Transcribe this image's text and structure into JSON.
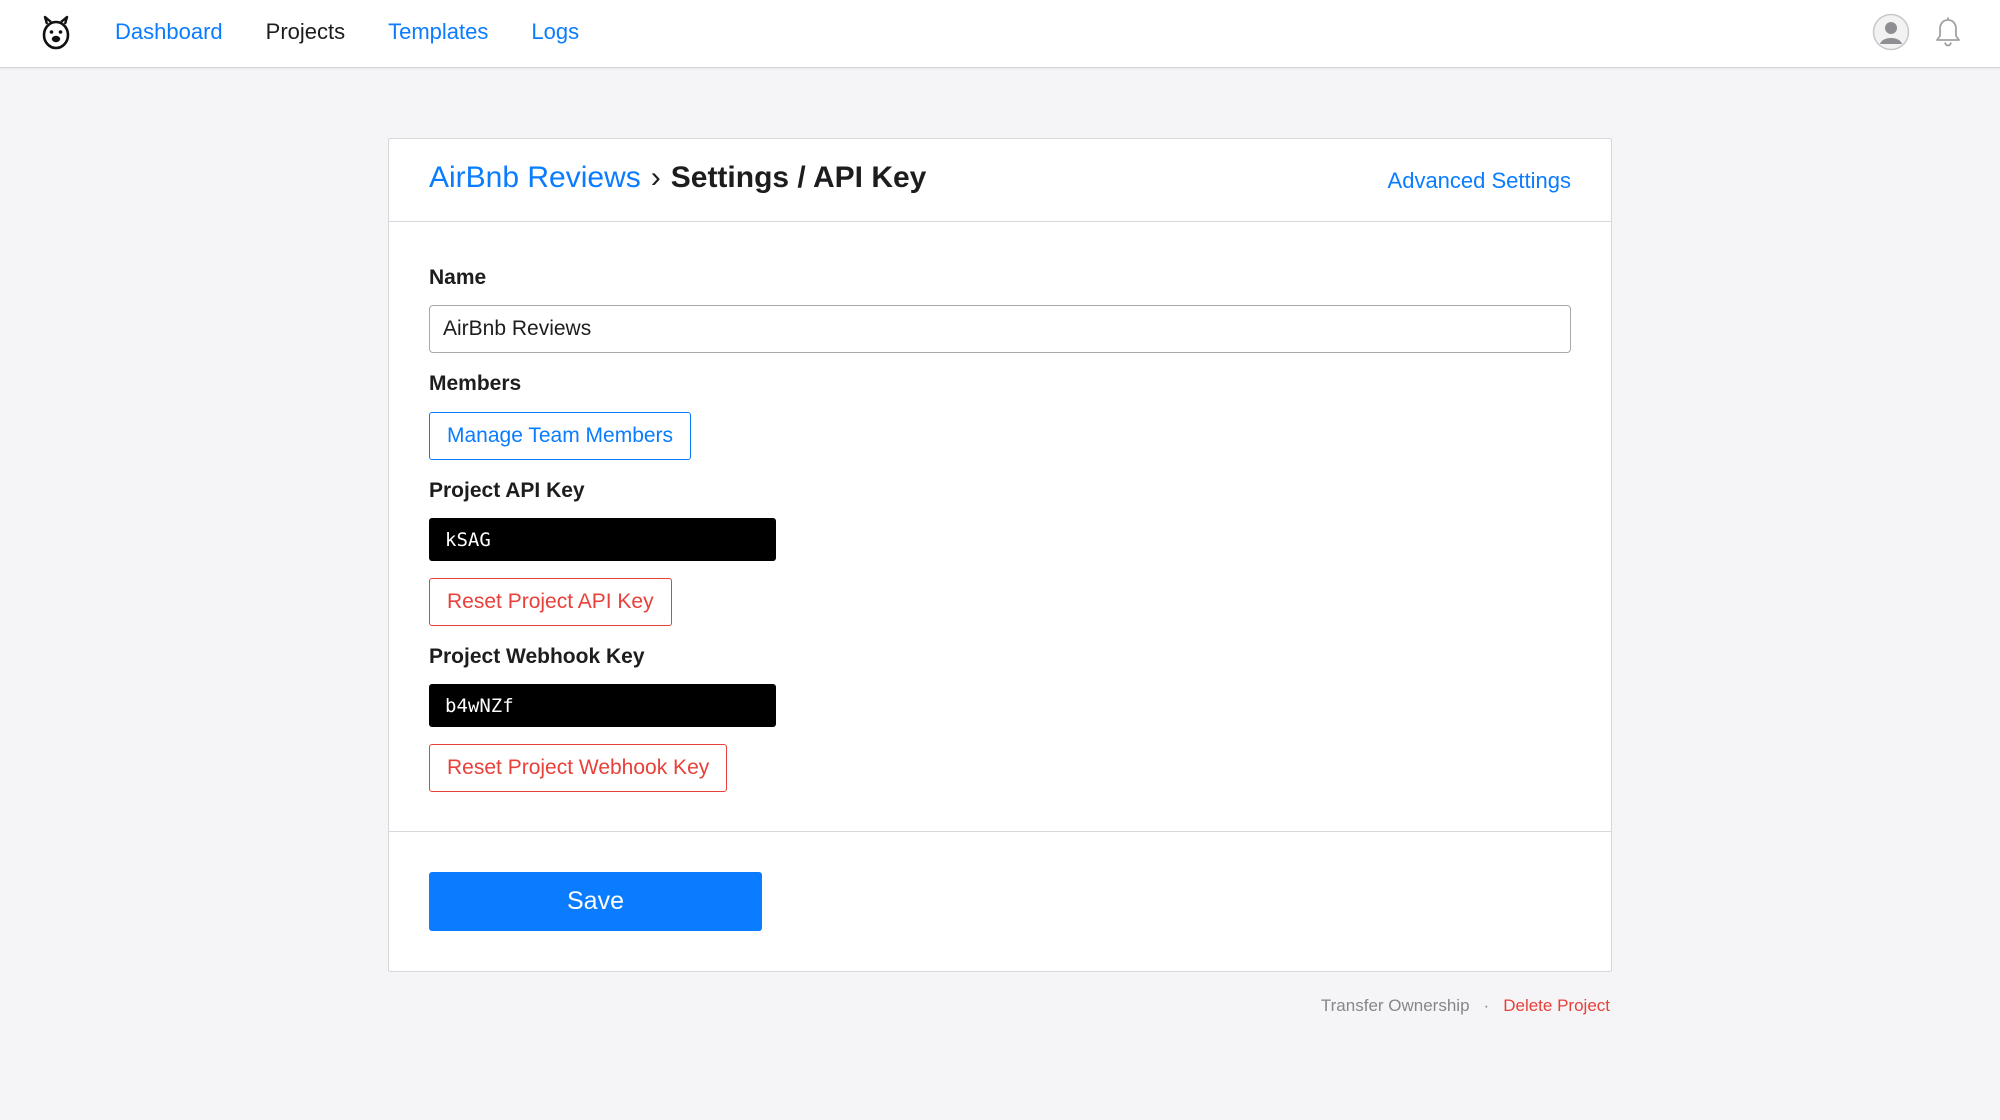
{
  "nav": {
    "items": [
      {
        "label": "Dashboard",
        "active": false
      },
      {
        "label": "Projects",
        "active": true
      },
      {
        "label": "Templates",
        "active": false
      },
      {
        "label": "Logs",
        "active": false
      }
    ]
  },
  "header": {
    "project_name": "AirBnb Reviews",
    "separator": "›",
    "current_page": "Settings / API Key",
    "advanced_link": "Advanced Settings"
  },
  "form": {
    "name_label": "Name",
    "name_value": "AirBnb Reviews",
    "members_label": "Members",
    "manage_members_button": "Manage Team Members",
    "api_key_label": "Project API Key",
    "api_key_value": "kSAG",
    "reset_api_key_button": "Reset Project API Key",
    "webhook_key_label": "Project Webhook Key",
    "webhook_key_value": "b4wNZf",
    "reset_webhook_key_button": "Reset Project Webhook Key",
    "save_button": "Save"
  },
  "footer": {
    "transfer_link": "Transfer Ownership",
    "separator": "·",
    "delete_link": "Delete Project"
  },
  "colors": {
    "accent": "#0a7cff",
    "danger": "#e8403a",
    "page_background": "#f5f5f7"
  },
  "icons": {
    "logo": "bear-logo-icon",
    "avatar": "user-avatar-icon",
    "notifications": "bell-icon"
  }
}
